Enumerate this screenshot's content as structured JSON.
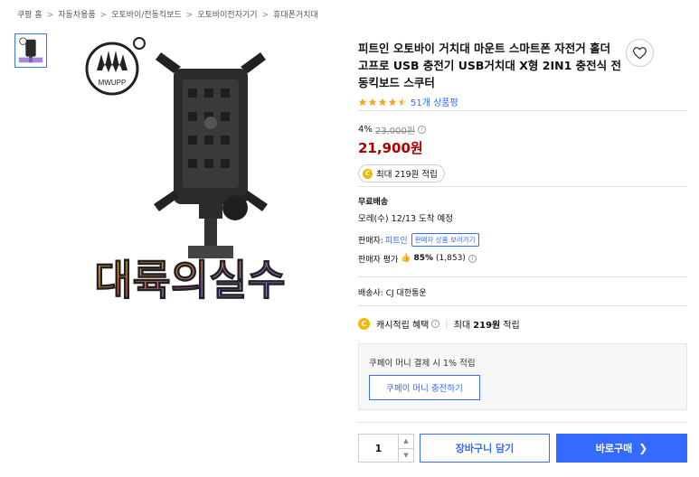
{
  "breadcrumb": [
    "쿠팡 홈",
    "자동차용품",
    "오토바이/전동킥보드",
    "오토바이전자기기",
    "휴대폰거치대"
  ],
  "breadcrumb_sep": ">",
  "image": {
    "logo_text": "MWUPP",
    "watermark_text": "대륙의실수"
  },
  "product": {
    "title": "피트인 오토바이 거치대 마운트 스마트폰 자전거 홀더 고프로 USB 충전기 USB거치대 X형 2IN1 충전식 전동킥보드 스쿠터",
    "review_count": "51개 상품평",
    "rating": 4.5
  },
  "price": {
    "discount": "4%",
    "original": "23,000원",
    "info_icon": "i",
    "sale": "21,900원",
    "reward_coin": "C",
    "reward": "최대 219원 적립"
  },
  "shipping": {
    "title": "무료배송",
    "eta": "모레(수) 12/13 도착 예정"
  },
  "seller": {
    "label": "판매자:",
    "name": "피트인",
    "more_button": "판매자 상품 보러가기",
    "rating_label": "판매자 평가",
    "rating_percent": "85%",
    "rating_count": "(1,853)"
  },
  "carrier": "배송사: CJ 대한통운",
  "cashback": {
    "coin": "C",
    "label": "캐시적립 혜택",
    "prefix": "최대",
    "amount": "219원",
    "suffix": "적립"
  },
  "coupay": {
    "text": "쿠페이 머니 결제 시 1% 적립",
    "button": "쿠페이 머니 충전하기"
  },
  "purchase": {
    "quantity": "1",
    "cart_button": "장바구니 담기",
    "buy_button": "바로구매"
  },
  "colors": {
    "accent": "#346aff",
    "sale_price": "#ae0000",
    "star": "#f5a623",
    "coin": "#f5b800"
  },
  "icons": {
    "wishlist": "heart-icon",
    "buy_chevron": "chevron-right-icon",
    "qty_up": "chevron-up-icon",
    "qty_down": "chevron-down-icon"
  }
}
